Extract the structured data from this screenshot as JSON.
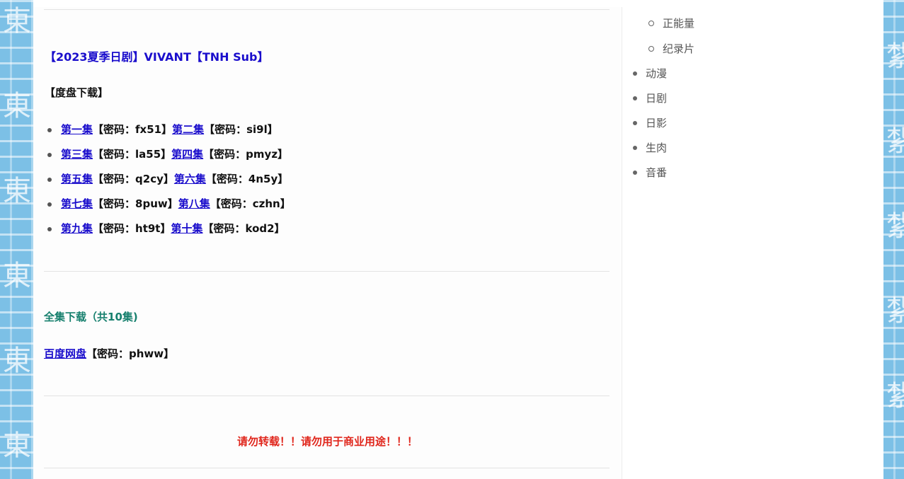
{
  "post": {
    "title": "【2023夏季日剧】VIVANT【TNH Sub】",
    "baidu_section_label": "【度盘下载】",
    "episodes": [
      {
        "a_label": "第一集",
        "a_code": "【密码：fx51】",
        "b_label": "第二集",
        "b_code": "【密码：si9l】"
      },
      {
        "a_label": "第三集",
        "a_code": "【密码：la55】",
        "b_label": "第四集",
        "b_code": "【密码：pmyz】"
      },
      {
        "a_label": "第五集",
        "a_code": "【密码：q2cy】",
        "b_label": "第六集",
        "b_code": "【密码：4n5y】"
      },
      {
        "a_label": "第七集",
        "a_code": "【密码：8puw】",
        "b_label": "第八集",
        "b_code": "【密码：czhn】"
      },
      {
        "a_label": "第九集",
        "a_code": "【密码：ht9t】",
        "b_label": "第十集",
        "b_code": "【密码：kod2】"
      }
    ],
    "full_download_title": "全集下载（共10集)",
    "baidu_link_label": "百度网盘",
    "baidu_code": "【密码：phww】",
    "warning": "请勿转载！！请勿用于商业用途！！！"
  },
  "sidebar": {
    "sub_items": [
      "正能量",
      "纪录片"
    ],
    "items": [
      "动漫",
      "日剧",
      "日影",
      "生肉",
      "音番"
    ]
  },
  "colors": {
    "link": "#1a0dcc",
    "full_download": "#17806e",
    "warning": "#e0261c",
    "side_pattern": "#7cc0e6"
  }
}
